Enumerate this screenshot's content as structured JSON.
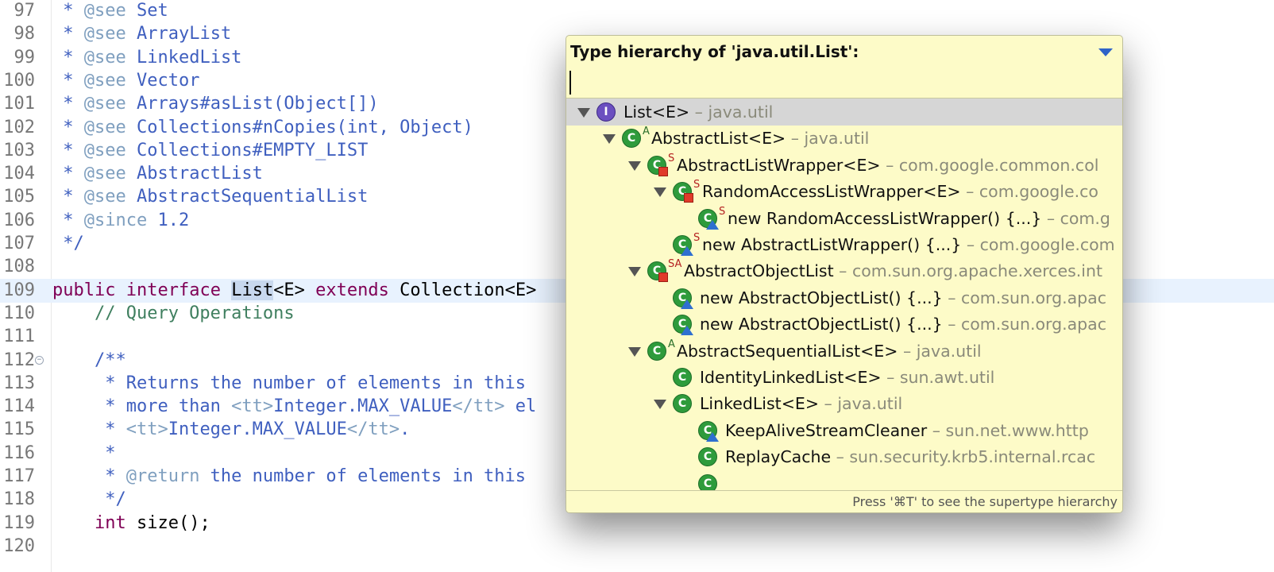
{
  "editor": {
    "lines": [
      {
        "num": "97",
        "segs": [
          {
            "t": " * ",
            "c": "t-doc"
          },
          {
            "t": "@see",
            "c": "t-tag"
          },
          {
            "t": " Set",
            "c": "t-doc"
          }
        ]
      },
      {
        "num": "98",
        "segs": [
          {
            "t": " * ",
            "c": "t-doc"
          },
          {
            "t": "@see",
            "c": "t-tag"
          },
          {
            "t": " ArrayList",
            "c": "t-doc"
          }
        ]
      },
      {
        "num": "99",
        "segs": [
          {
            "t": " * ",
            "c": "t-doc"
          },
          {
            "t": "@see",
            "c": "t-tag"
          },
          {
            "t": " LinkedList",
            "c": "t-doc"
          }
        ]
      },
      {
        "num": "100",
        "segs": [
          {
            "t": " * ",
            "c": "t-doc"
          },
          {
            "t": "@see",
            "c": "t-tag"
          },
          {
            "t": " Vector",
            "c": "t-doc"
          }
        ]
      },
      {
        "num": "101",
        "segs": [
          {
            "t": " * ",
            "c": "t-doc"
          },
          {
            "t": "@see",
            "c": "t-tag"
          },
          {
            "t": " Arrays#asList(Object[])",
            "c": "t-doc"
          }
        ]
      },
      {
        "num": "102",
        "segs": [
          {
            "t": " * ",
            "c": "t-doc"
          },
          {
            "t": "@see",
            "c": "t-tag"
          },
          {
            "t": " Collections#nCopies(int, Object)",
            "c": "t-doc"
          }
        ]
      },
      {
        "num": "103",
        "segs": [
          {
            "t": " * ",
            "c": "t-doc"
          },
          {
            "t": "@see",
            "c": "t-tag"
          },
          {
            "t": " Collections#EMPTY_LIST",
            "c": "t-doc"
          }
        ]
      },
      {
        "num": "104",
        "segs": [
          {
            "t": " * ",
            "c": "t-doc"
          },
          {
            "t": "@see",
            "c": "t-tag"
          },
          {
            "t": " AbstractList",
            "c": "t-doc"
          }
        ]
      },
      {
        "num": "105",
        "segs": [
          {
            "t": " * ",
            "c": "t-doc"
          },
          {
            "t": "@see",
            "c": "t-tag"
          },
          {
            "t": " AbstractSequentialList",
            "c": "t-doc"
          }
        ]
      },
      {
        "num": "106",
        "segs": [
          {
            "t": " * ",
            "c": "t-doc"
          },
          {
            "t": "@since",
            "c": "t-tag"
          },
          {
            "t": " 1.2",
            "c": "t-doc"
          }
        ]
      },
      {
        "num": "107",
        "segs": [
          {
            "t": " */",
            "c": "t-doc"
          }
        ]
      },
      {
        "num": "108",
        "segs": []
      },
      {
        "num": "109",
        "current": true,
        "segs": [
          {
            "t": "public",
            "c": "t-kw"
          },
          {
            "t": " ",
            "c": "t-txt"
          },
          {
            "t": "interface",
            "c": "t-kw"
          },
          {
            "t": " ",
            "c": "t-txt"
          },
          {
            "t": "List",
            "c": "t-txt t-sel"
          },
          {
            "t": "<E> ",
            "c": "t-txt"
          },
          {
            "t": "extends",
            "c": "t-kw"
          },
          {
            "t": " Collection<E>",
            "c": "t-txt"
          }
        ]
      },
      {
        "num": "110",
        "segs": [
          {
            "t": "    // Query Operations",
            "c": "t-com"
          }
        ]
      },
      {
        "num": "111",
        "segs": []
      },
      {
        "num": "112",
        "fold": true,
        "segs": [
          {
            "t": "    /**",
            "c": "t-doc"
          }
        ]
      },
      {
        "num": "113",
        "segs": [
          {
            "t": "     * Returns the number of elements in this",
            "c": "t-doc"
          }
        ]
      },
      {
        "num": "114",
        "segs": [
          {
            "t": "     * more than ",
            "c": "t-doc"
          },
          {
            "t": "<tt>",
            "c": "t-tag"
          },
          {
            "t": "Integer.MAX_VALUE",
            "c": "t-doc"
          },
          {
            "t": "</tt>",
            "c": "t-tag"
          },
          {
            "t": " el",
            "c": "t-doc"
          }
        ]
      },
      {
        "num": "115",
        "segs": [
          {
            "t": "     * ",
            "c": "t-doc"
          },
          {
            "t": "<tt>",
            "c": "t-tag"
          },
          {
            "t": "Integer.MAX_VALUE",
            "c": "t-doc"
          },
          {
            "t": "</tt>",
            "c": "t-tag"
          },
          {
            "t": ".",
            "c": "t-doc"
          }
        ]
      },
      {
        "num": "116",
        "segs": [
          {
            "t": "     *",
            "c": "t-doc"
          }
        ]
      },
      {
        "num": "117",
        "segs": [
          {
            "t": "     * ",
            "c": "t-doc"
          },
          {
            "t": "@return",
            "c": "t-tag"
          },
          {
            "t": " the number of elements in this",
            "c": "t-doc"
          }
        ]
      },
      {
        "num": "118",
        "segs": [
          {
            "t": "     */",
            "c": "t-doc"
          }
        ]
      },
      {
        "num": "119",
        "segs": [
          {
            "t": "    ",
            "c": "t-txt"
          },
          {
            "t": "int",
            "c": "t-kw"
          },
          {
            "t": " size();",
            "c": "t-txt"
          }
        ]
      },
      {
        "num": "120",
        "segs": []
      }
    ]
  },
  "popup": {
    "title": "Type hierarchy of 'java.util.List':",
    "filter_value": "",
    "footer": "Press '⌘T' to see the supertype hierarchy",
    "items": [
      {
        "name": "List<E>",
        "pkg": " – java.util",
        "level": 0,
        "twisty": true,
        "kind": "iface",
        "selected": true
      },
      {
        "name": "AbstractList<E>",
        "pkg": " – java.util",
        "level": 1,
        "twisty": true,
        "kind": "class",
        "letter": "A"
      },
      {
        "name": "AbstractListWrapper<E>",
        "pkg": " – com.google.common.col",
        "level": 2,
        "twisty": true,
        "kind": "class",
        "letter": "S",
        "sq": true
      },
      {
        "name": "RandomAccessListWrapper<E>",
        "pkg": " – com.google.co",
        "level": 3,
        "twisty": true,
        "kind": "class",
        "letter": "S",
        "sq": true
      },
      {
        "name": "new RandomAccessListWrapper() {...}",
        "pkg": " – com.g",
        "level": 4,
        "twisty": false,
        "kind": "class",
        "letter": "S",
        "tri": true
      },
      {
        "name": "new AbstractListWrapper() {...}",
        "pkg": " – com.google.com",
        "level": 3,
        "twisty": false,
        "kind": "class",
        "letter": "S",
        "tri": true
      },
      {
        "name": "AbstractObjectList",
        "pkg": " – com.sun.org.apache.xerces.int",
        "level": 2,
        "twisty": true,
        "kind": "class",
        "letter": "SA",
        "sq": true
      },
      {
        "name": "new AbstractObjectList() {...}",
        "pkg": " – com.sun.org.apac",
        "level": 3,
        "twisty": false,
        "kind": "class",
        "tri": true
      },
      {
        "name": "new AbstractObjectList() {...}",
        "pkg": " – com.sun.org.apac",
        "level": 3,
        "twisty": false,
        "kind": "class",
        "tri": true
      },
      {
        "name": "AbstractSequentialList<E>",
        "pkg": " – java.util",
        "level": 2,
        "twisty": true,
        "kind": "class",
        "letter": "A"
      },
      {
        "name": "IdentityLinkedList<E>",
        "pkg": " – sun.awt.util",
        "level": 3,
        "twisty": false,
        "kind": "class"
      },
      {
        "name": "LinkedList<E>",
        "pkg": " – java.util",
        "level": 3,
        "twisty": true,
        "kind": "class"
      },
      {
        "name": "KeepAliveStreamCleaner",
        "pkg": " – sun.net.www.http",
        "level": 4,
        "twisty": false,
        "kind": "class",
        "tri": true
      },
      {
        "name": "ReplayCache",
        "pkg": " – sun.security.krb5.internal.rcac",
        "level": 4,
        "twisty": false,
        "kind": "class"
      },
      {
        "name": "",
        "pkg": "",
        "level": 4,
        "twisty": false,
        "kind": "class"
      }
    ]
  }
}
